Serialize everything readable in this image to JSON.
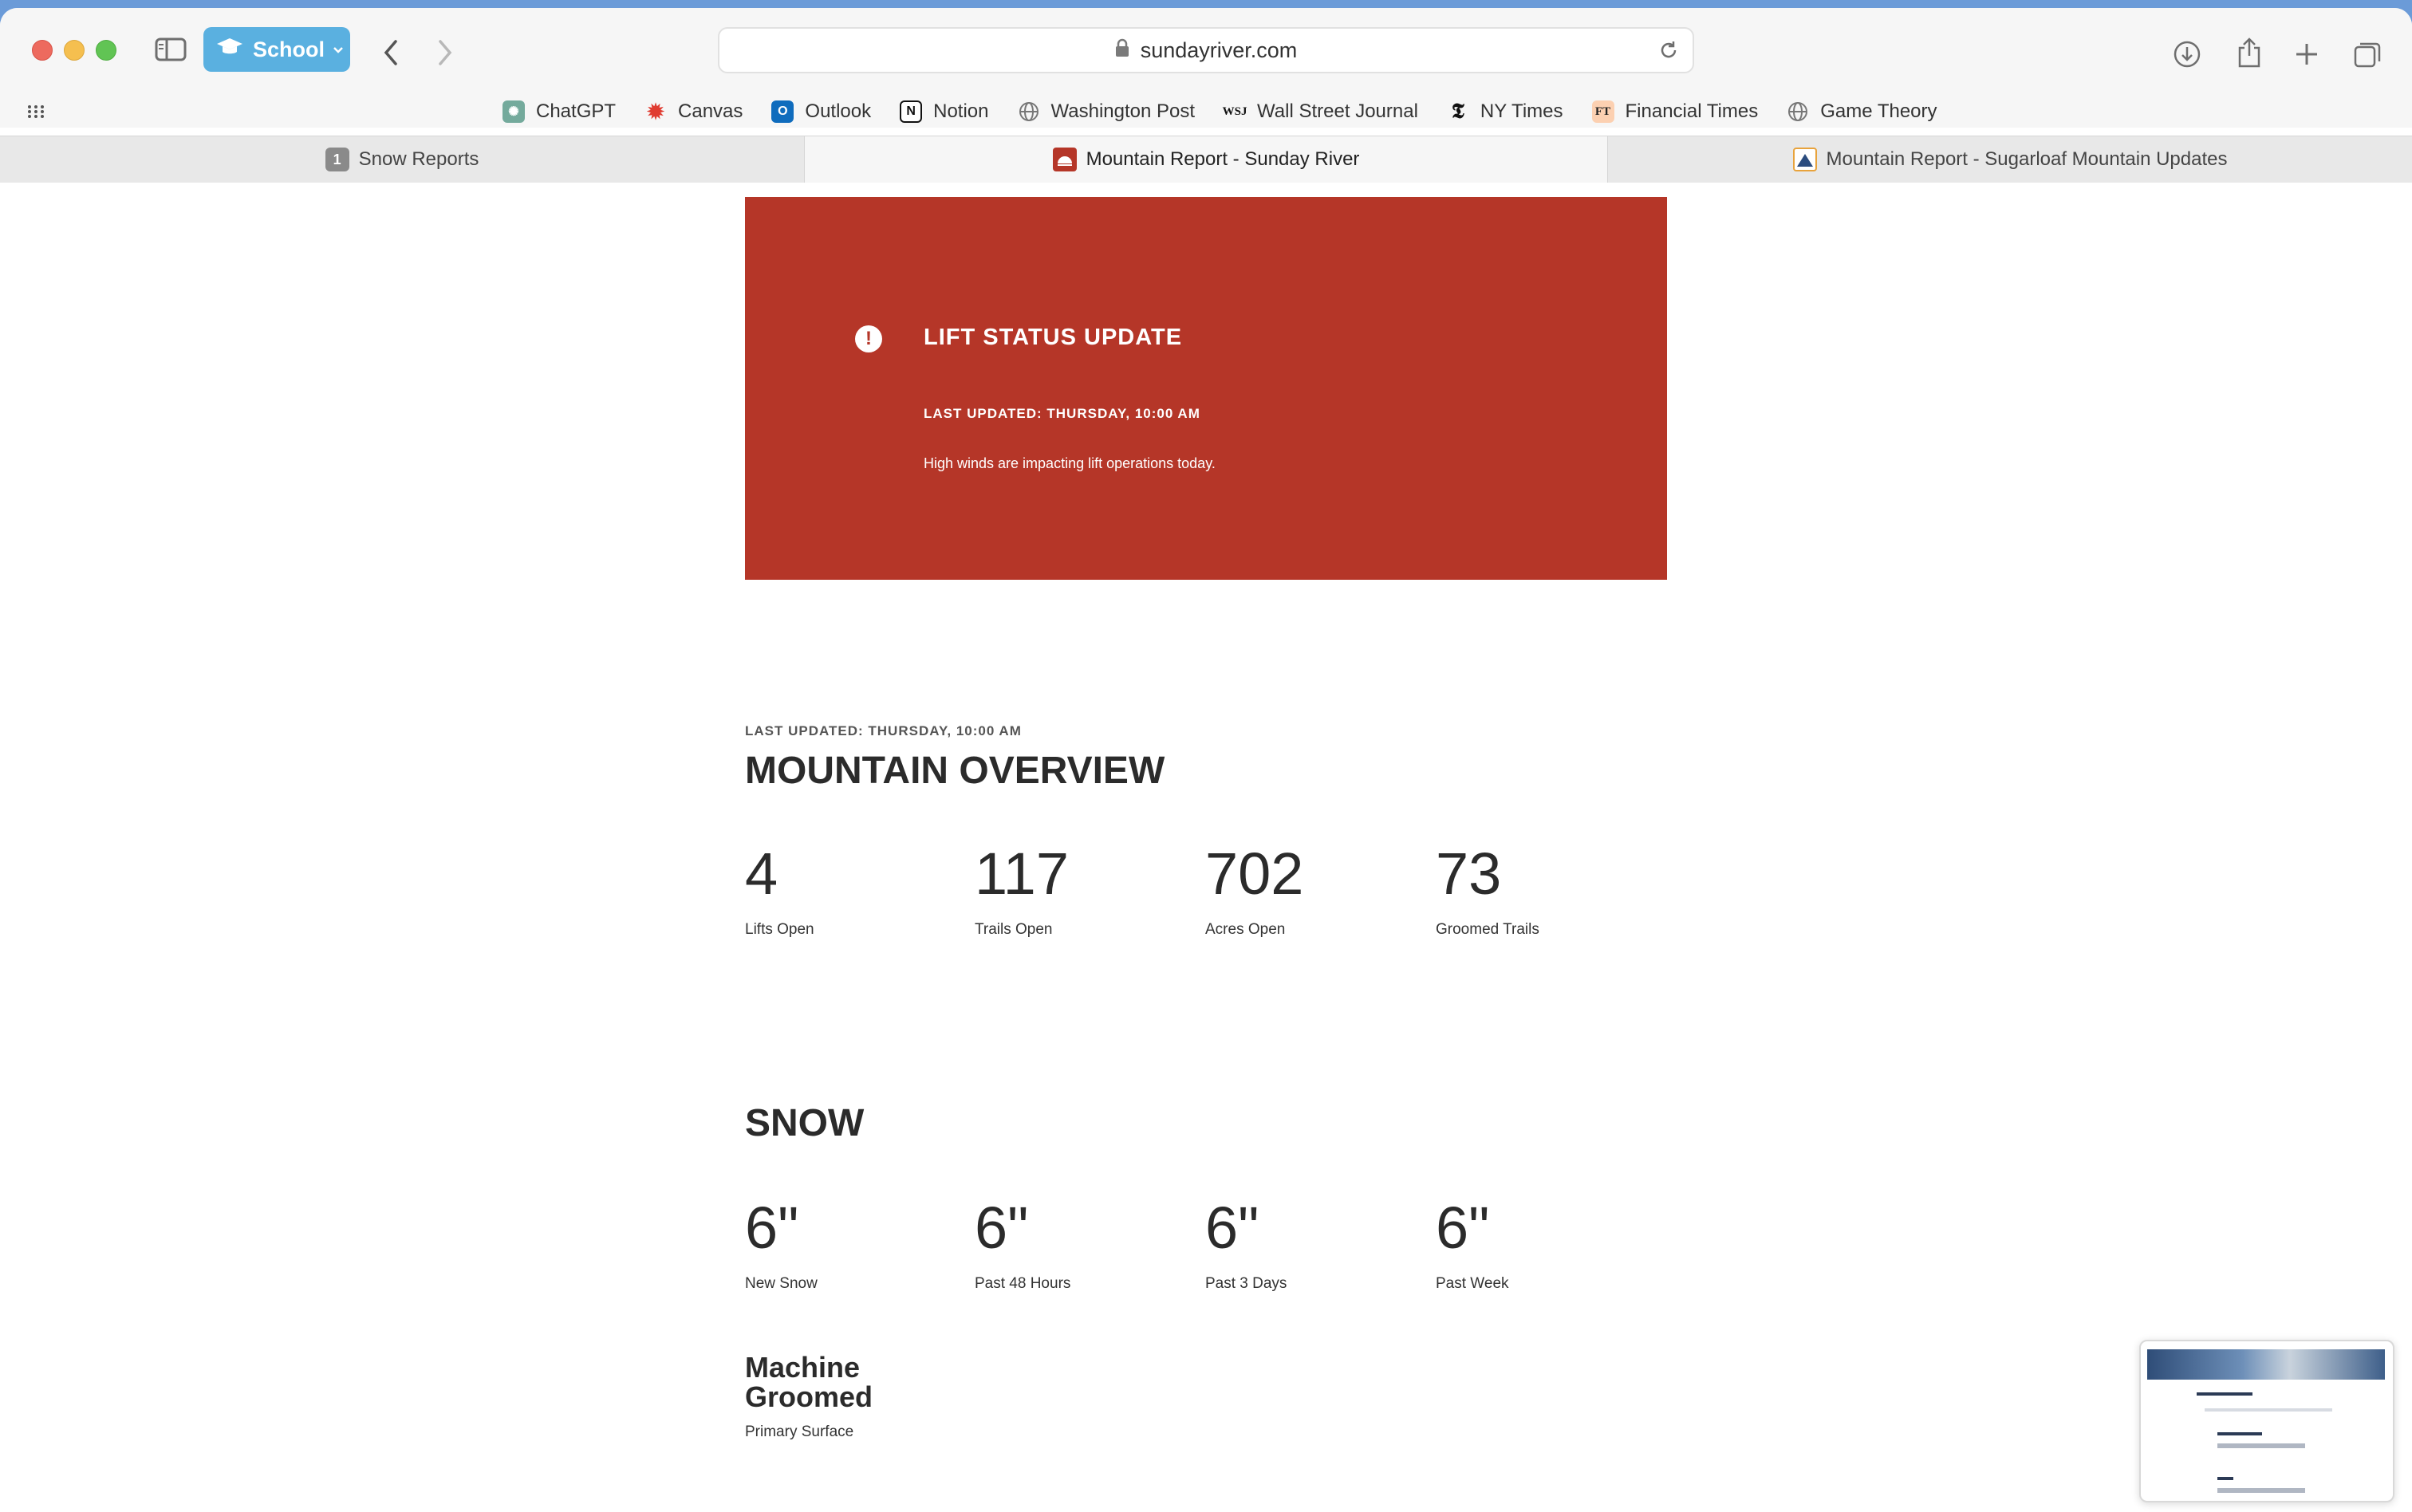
{
  "browser": {
    "profile": "School",
    "url": "sundayriver.com",
    "bookmarks": [
      {
        "label": "ChatGPT",
        "icon": "chatgpt-icon"
      },
      {
        "label": "Canvas",
        "icon": "canvas-icon"
      },
      {
        "label": "Outlook",
        "icon": "outlook-icon"
      },
      {
        "label": "Notion",
        "icon": "notion-icon"
      },
      {
        "label": "Washington Post",
        "icon": "globe-icon"
      },
      {
        "label": "Wall Street Journal",
        "icon": "wsj-icon"
      },
      {
        "label": "NY Times",
        "icon": "nyt-icon"
      },
      {
        "label": "Financial Times",
        "icon": "ft-icon"
      },
      {
        "label": "Game Theory",
        "icon": "globe-icon"
      }
    ],
    "bookmark_badges": {
      "wsj": "WSJ",
      "nyt": "𝕿",
      "ft": "FT"
    },
    "tabs": [
      {
        "label": "Snow Reports",
        "badge": "1"
      },
      {
        "label": "Mountain Report - Sunday River",
        "active": true
      },
      {
        "label": "Mountain Report - Sugarloaf Mountain Updates"
      }
    ]
  },
  "alert": {
    "title": "LIFT STATUS UPDATE",
    "updated": "LAST UPDATED: THURSDAY, 10:00 AM",
    "message": "High winds are impacting lift operations today."
  },
  "overview": {
    "updated": "LAST UPDATED: THURSDAY, 10:00 AM",
    "title": "MOUNTAIN OVERVIEW",
    "stats": [
      {
        "value": "4",
        "label": "Lifts Open"
      },
      {
        "value": "117",
        "label": "Trails Open"
      },
      {
        "value": "702",
        "label": "Acres Open"
      },
      {
        "value": "73",
        "label": "Groomed Trails"
      }
    ]
  },
  "snow": {
    "title": "SNOW",
    "stats": [
      {
        "value": "6\"",
        "label": "New Snow"
      },
      {
        "value": "6\"",
        "label": "Past 48 Hours"
      },
      {
        "value": "6\"",
        "label": "Past 3 Days"
      },
      {
        "value": "6\"",
        "label": "Past Week"
      }
    ],
    "surface_title": "Machine Groomed",
    "surface_label": "Primary Surface"
  },
  "colors": {
    "alert_bg": "#b53628",
    "profile": "#5ab0e0"
  }
}
